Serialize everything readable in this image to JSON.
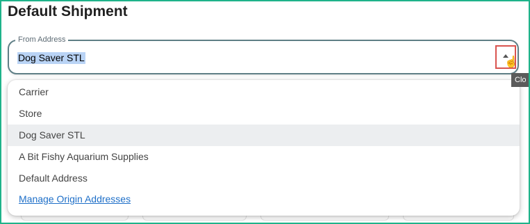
{
  "page": {
    "title": "Default Shipment"
  },
  "from_address": {
    "label": "From Address",
    "value": "Dog Saver STL"
  },
  "tooltip": {
    "text": "Clo"
  },
  "dropdown": {
    "options": [
      {
        "label": "Carrier"
      },
      {
        "label": "Store"
      },
      {
        "label": "Dog Saver STL"
      },
      {
        "label": "A Bit Fishy Aquarium Supplies"
      },
      {
        "label": "Default Address"
      }
    ],
    "selected": "Dog Saver STL",
    "manage_link": "Manage Origin Addresses"
  },
  "icons": {
    "toggle": "chevron-up-icon",
    "cursor": "hand-pointer-icon"
  }
}
